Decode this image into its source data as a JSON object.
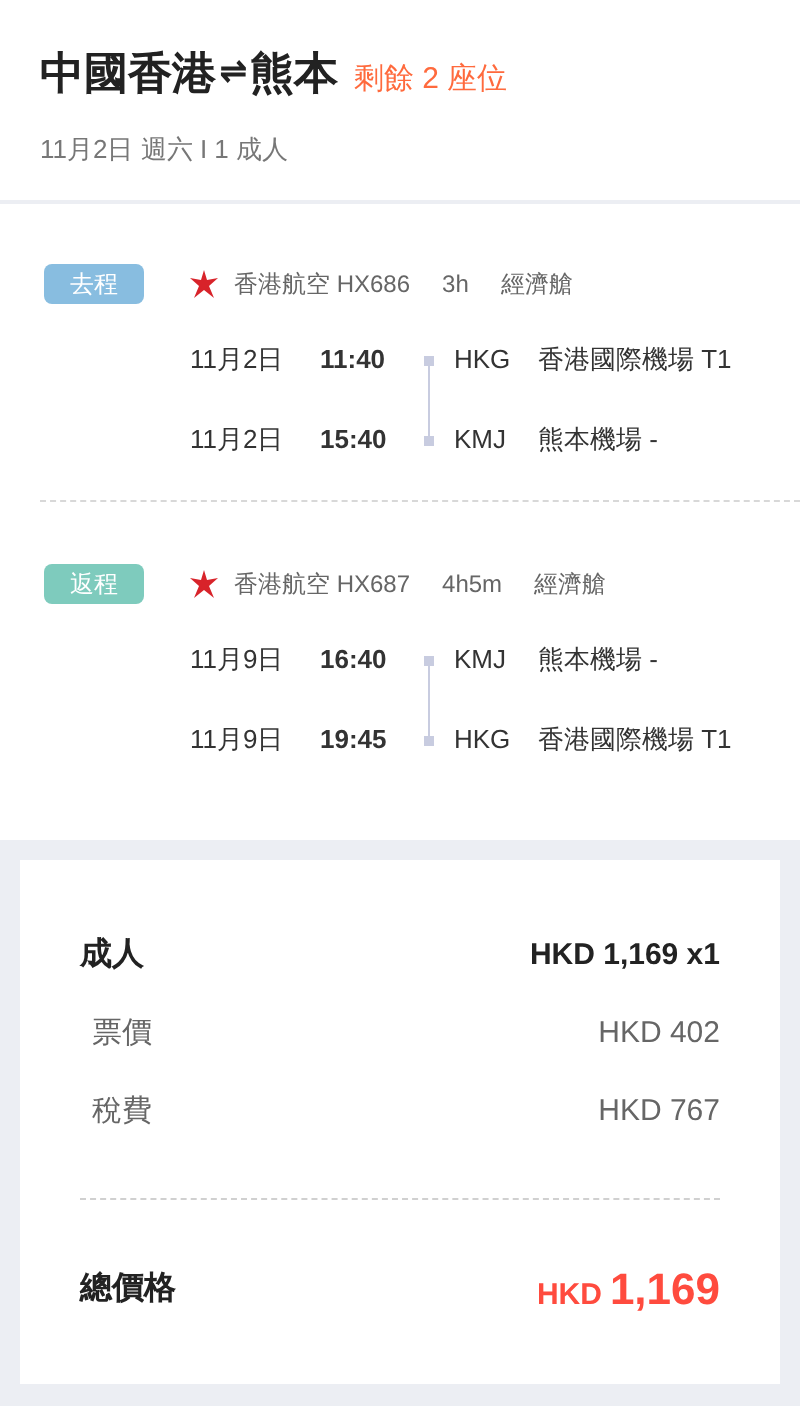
{
  "header": {
    "origin": "中國香港",
    "arrow": "⇌",
    "destination": "熊本",
    "seats_left": "剩餘 2 座位",
    "subtitle": "11月2日 週六 I 1 成人"
  },
  "legs": [
    {
      "tag": "去程",
      "color": "#88bde0",
      "airline": "香港航空 HX686",
      "duration": "3h",
      "cabin": "經濟艙",
      "stops": [
        {
          "date": "11月2日",
          "time": "11:40",
          "code": "HKG",
          "airport": "香港國際機場 T1"
        },
        {
          "date": "11月2日",
          "time": "15:40",
          "code": "KMJ",
          "airport": "熊本機場 -"
        }
      ]
    },
    {
      "tag": "返程",
      "color": "#7ecbbd",
      "airline": "香港航空 HX687",
      "duration": "4h5m",
      "cabin": "經濟艙",
      "stops": [
        {
          "date": "11月9日",
          "time": "16:40",
          "code": "KMJ",
          "airport": "熊本機場 -"
        },
        {
          "date": "11月9日",
          "time": "19:45",
          "code": "HKG",
          "airport": "香港國際機場 T1"
        }
      ]
    }
  ],
  "price": {
    "passenger": "成人",
    "passenger_total": "HKD 1,169 x1",
    "items": [
      {
        "label": "票價",
        "amount": "HKD 402"
      },
      {
        "label": "稅費",
        "amount": "HKD 767"
      }
    ],
    "total_label": "總價格",
    "total_currency": "HKD",
    "total_amount": "1,169"
  }
}
